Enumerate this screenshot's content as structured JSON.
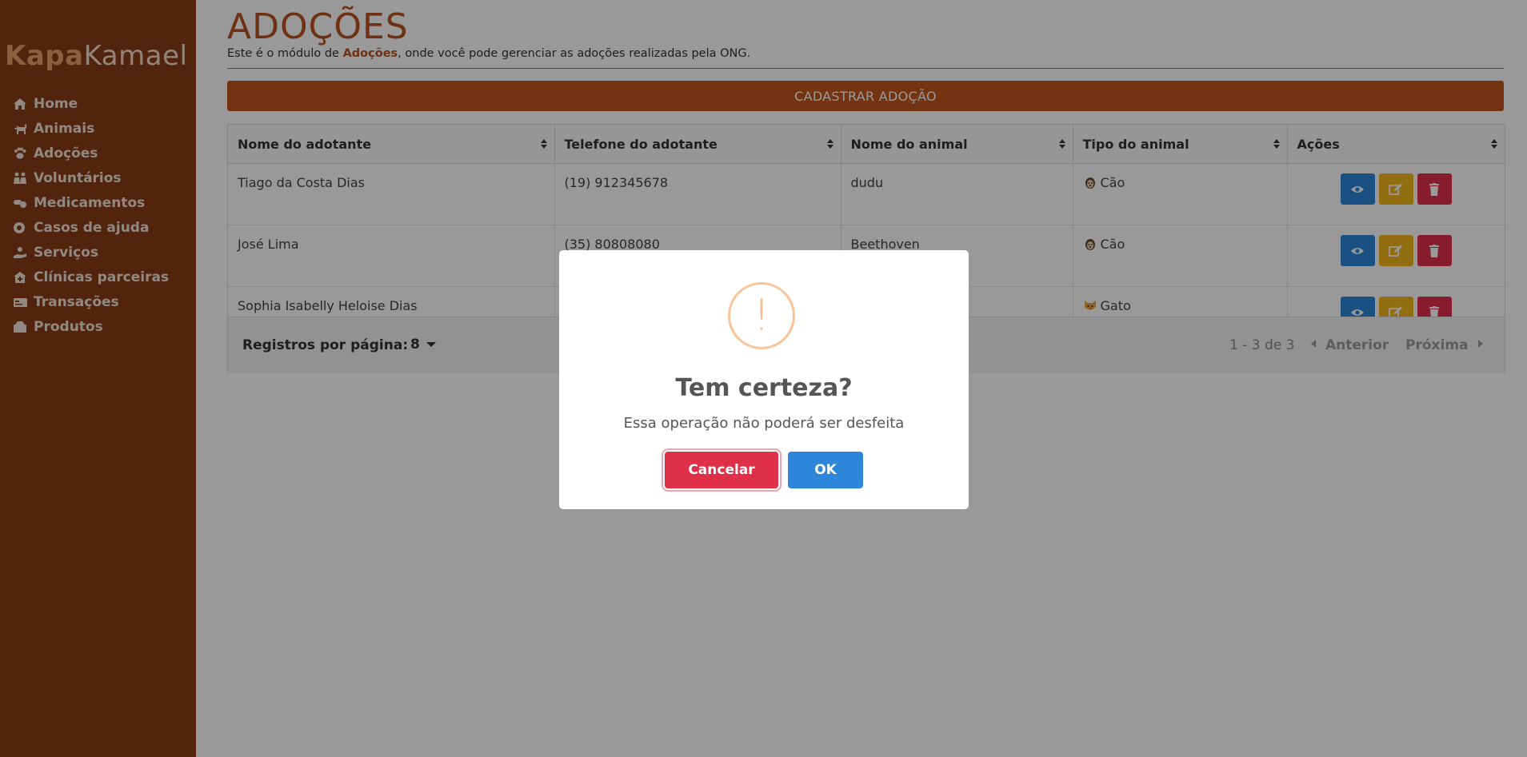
{
  "brand": {
    "part1": "Kapa",
    "part2": "Kamael"
  },
  "sidebar": {
    "items": [
      {
        "label": "Home",
        "icon": "home-icon"
      },
      {
        "label": "Animais",
        "icon": "dog-icon"
      },
      {
        "label": "Adoções",
        "icon": "paw-icon"
      },
      {
        "label": "Voluntários",
        "icon": "people-icon"
      },
      {
        "label": "Medicamentos",
        "icon": "pills-icon"
      },
      {
        "label": "Casos de ajuda",
        "icon": "lifering-icon"
      },
      {
        "label": "Serviços",
        "icon": "hand-icon"
      },
      {
        "label": "Clínicas parceiras",
        "icon": "clinic-icon"
      },
      {
        "label": "Transações",
        "icon": "card-icon"
      },
      {
        "label": "Produtos",
        "icon": "box-icon"
      }
    ]
  },
  "page": {
    "title": "ADOÇÕES",
    "subtitle_pre": "Este é o módulo de ",
    "subtitle_highlight": "Adoções",
    "subtitle_post": ", onde você pode gerenciar as adoções realizadas pela ONG.",
    "cta_label": "CADASTRAR ADOÇÃO"
  },
  "table": {
    "columns": [
      "Nome do adotante",
      "Telefone do adotante",
      "Nome do animal",
      "Tipo do animal",
      "Ações"
    ],
    "rows": [
      {
        "adopter": "Tiago da Costa Dias",
        "phone": "(19) 912345678",
        "animal": "dudu",
        "type": "Cão",
        "type_icon": "dog-face-icon"
      },
      {
        "adopter": "José Lima",
        "phone": "(35) 80808080",
        "animal": "Beethoven",
        "type": "Cão",
        "type_icon": "dog-face-icon"
      },
      {
        "adopter": "Sophia Isabelly Heloise Dias",
        "phone": "",
        "animal": "",
        "type": "Gato",
        "type_icon": "cat-face-icon"
      }
    ]
  },
  "pagination": {
    "per_page_label": "Registros por página:",
    "per_page_value": "8",
    "range": "1 - 3 de 3",
    "prev": "Anterior",
    "next": "Próxima"
  },
  "modal": {
    "icon": "!",
    "title": "Tem certeza?",
    "text": "Essa operação não poderá ser desfeita",
    "cancel": "Cancelar",
    "ok": "OK"
  },
  "colors": {
    "sidebar": "#8a3d16",
    "accent": "#c1561d",
    "view": "#2d86d9",
    "edit": "#f3b81d",
    "delete": "#e0304a"
  }
}
